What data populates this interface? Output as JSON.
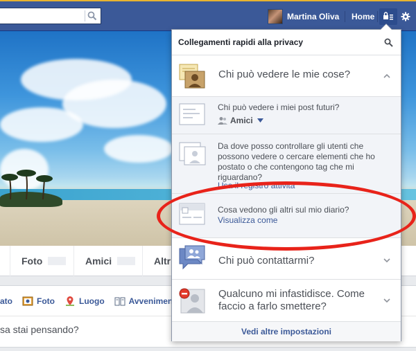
{
  "topbar": {
    "search_placeholder": "",
    "profile_name": "Martina Oliva",
    "home_label": "Home"
  },
  "profile_tabs": [
    {
      "label": "Foto"
    },
    {
      "label": "Amici"
    },
    {
      "label": "Altr"
    }
  ],
  "composer": {
    "actions": [
      {
        "label": "ato"
      },
      {
        "label": "Foto"
      },
      {
        "label": "Luogo"
      },
      {
        "label": "Avvenimen"
      }
    ],
    "placeholder": "sa stai pensando?"
  },
  "privacy_panel": {
    "title": "Collegamenti rapidi alla privacy",
    "section_visibility": {
      "label": "Chi può vedere le mie cose?",
      "items": [
        {
          "question": "Chi può vedere i miei post futuri?",
          "audience": "Amici"
        },
        {
          "question": "Da dove posso controllare gli utenti che possono vedere o cercare elementi che ho postato o che contengono tag che mi riguardano?",
          "link": "Usa il registro attività"
        },
        {
          "question": "Cosa vedono gli altri sul mio diario?",
          "link": "Visualizza come"
        }
      ]
    },
    "section_contact": {
      "label": "Chi può contattarmi?"
    },
    "section_block": {
      "label": "Qualcuno mi infastidisce. Come faccio a farlo smettere?"
    },
    "footer_link": "Vedi altre impostazioni"
  },
  "colors": {
    "brand_blue": "#3b5998",
    "annotation_red": "#e8231a"
  }
}
